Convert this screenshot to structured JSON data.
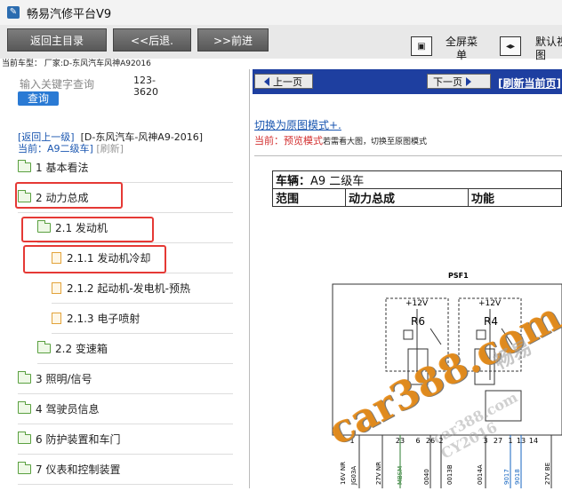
{
  "app": {
    "title": "畅易汽修平台V9"
  },
  "toolbar": {
    "home": "返回主目录",
    "back": "<<后退.",
    "forward": ">>前进",
    "fullscreen": "全屏菜单",
    "default_view": "默认视图"
  },
  "status": {
    "current_model": "当前车型： 厂家:D-东风汽车风神A92016"
  },
  "search": {
    "placeholder": "输入关键字查询",
    "button": "查询",
    "count_line1": "123-",
    "count_line2": "3620"
  },
  "breadcrumb": {
    "up": "[返回上一级]",
    "path": "[D-东风汽车-风神A9-2016]",
    "current": "当前：A9二级车]",
    "refresh": "[刷新]"
  },
  "tree": {
    "items": [
      {
        "label": "1 基本看法"
      },
      {
        "label": "2 动力总成"
      },
      {
        "label": "2.1 发动机"
      },
      {
        "label": "2.1.1 发动机冷却"
      },
      {
        "label": "2.1.2 起动机-发电机-预热"
      },
      {
        "label": "2.1.3 电子喷射"
      },
      {
        "label": "2.2 变速箱"
      },
      {
        "label": "3 照明/信号"
      },
      {
        "label": "4 驾驶员信息"
      },
      {
        "label": "6 防护装置和车门"
      },
      {
        "label": "7 仪表和控制装置"
      }
    ]
  },
  "viewer": {
    "prev": "上一页",
    "next": "下一页",
    "refresh": "[刷新当前页]",
    "mode_link": "切换为原图模式+.",
    "mode_current": "当前：预览模式",
    "mode_hint": "若需看大图，切换至原图模式"
  },
  "doc": {
    "vehicle_label": "车辆：",
    "vehicle_value": "A9 二级车",
    "scope": "范围",
    "system": "动力总成",
    "function": "功能"
  },
  "diagram": {
    "box": "PSF1",
    "relay1": "R6",
    "relay2": "R4",
    "v1": "+12V",
    "v2": "+12V",
    "pins": [
      "1",
      "23",
      "6",
      "26",
      "2",
      "3",
      "27",
      "1",
      "13",
      "14"
    ],
    "wires": [
      "16V NR",
      "JG03A",
      "27V NR",
      "MBSM",
      "0040",
      "0013B",
      "0014A",
      "9017",
      "9018",
      "27V BE"
    ]
  },
  "watermark": {
    "main": "car388.com",
    "sub": "畅易",
    "faint": "car388.com CY2016"
  },
  "colors": {
    "navbar": "#1e3fa0",
    "highlight": "#e53935",
    "link": "#1a56b0"
  }
}
